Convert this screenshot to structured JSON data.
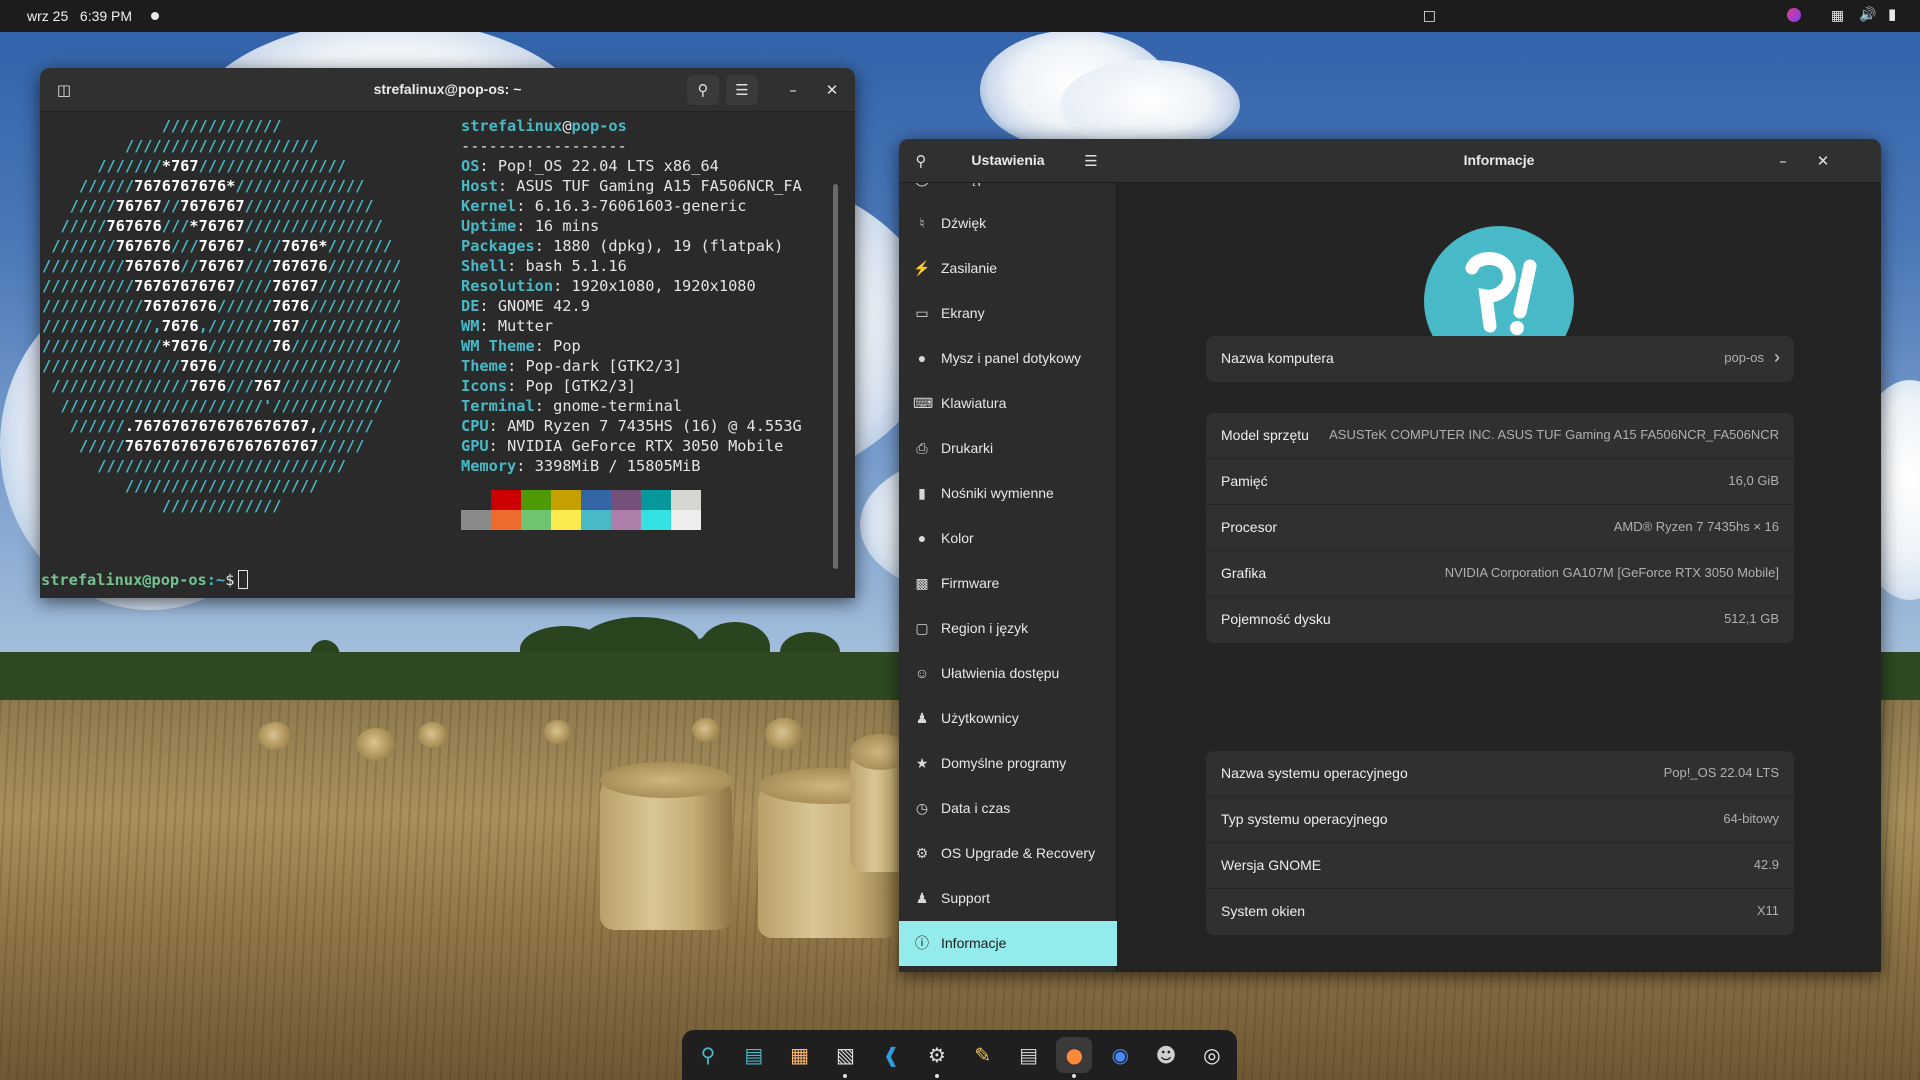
{
  "topbar": {
    "date": "wrz 25",
    "time": "6:39 PM",
    "tray_icons": [
      "screen-share-icon",
      "profile-icon",
      "keyboard-icon",
      "volume-icon",
      "battery-icon"
    ]
  },
  "terminal": {
    "title": "strefalinux@pop-os: ~",
    "neofetch": {
      "user": "strefalinux",
      "at": "@",
      "host": "pop-os",
      "separator": "------------------",
      "fields": [
        {
          "key": "OS",
          "value": "Pop!_OS 22.04 LTS x86_64"
        },
        {
          "key": "Host",
          "value": "ASUS TUF Gaming A15 FA506NCR_FA"
        },
        {
          "key": "Kernel",
          "value": "6.16.3-76061603-generic"
        },
        {
          "key": "Uptime",
          "value": "16 mins"
        },
        {
          "key": "Packages",
          "value": "1880 (dpkg), 19 (flatpak)"
        },
        {
          "key": "Shell",
          "value": "bash 5.1.16"
        },
        {
          "key": "Resolution",
          "value": "1920x1080, 1920x1080"
        },
        {
          "key": "DE",
          "value": "GNOME 42.9"
        },
        {
          "key": "WM",
          "value": "Mutter"
        },
        {
          "key": "WM Theme",
          "value": "Pop"
        },
        {
          "key": "Theme",
          "value": "Pop-dark [GTK2/3]"
        },
        {
          "key": "Icons",
          "value": "Pop [GTK2/3]"
        },
        {
          "key": "Terminal",
          "value": "gnome-terminal"
        },
        {
          "key": "CPU",
          "value": "AMD Ryzen 7 7435HS (16) @ 4.553G"
        },
        {
          "key": "GPU",
          "value": "NVIDIA GeForce RTX 3050 Mobile"
        },
        {
          "key": "Memory",
          "value": "3398MiB / 15805MiB"
        }
      ],
      "palette_top": [
        "#2a2a2a",
        "#cc0000",
        "#4e9a06",
        "#c4a000",
        "#3465a4",
        "#75507b",
        "#06989a",
        "#d3d7cf"
      ],
      "palette_bottom": [
        "#8a8a8a",
        "#ef6a2d",
        "#6fc46f",
        "#fce94f",
        "#48b9c7",
        "#ad7fa8",
        "#34e2e2",
        "#eeeeec"
      ]
    },
    "prompt_user": "strefalinux@pop-os",
    "prompt_path": ":~",
    "prompt_symbol": "$"
  },
  "settings": {
    "sidebar_title": "Ustawienia",
    "main_title": "Informacje",
    "sidebar_items": [
      {
        "label": "Dostępność",
        "icon": "accessibility-icon"
      },
      {
        "label": "Dźwięk",
        "icon": "sound-icon"
      },
      {
        "label": "Zasilanie",
        "icon": "power-icon"
      },
      {
        "label": "Ekrany",
        "icon": "display-icon"
      },
      {
        "label": "Mysz i panel dotykowy",
        "icon": "mouse-icon"
      },
      {
        "label": "Klawiatura",
        "icon": "keyboard-icon"
      },
      {
        "label": "Drukarki",
        "icon": "printer-icon"
      },
      {
        "label": "Nośniki wymienne",
        "icon": "removable-media-icon"
      },
      {
        "label": "Kolor",
        "icon": "color-icon"
      },
      {
        "label": "Firmware",
        "icon": "firmware-icon"
      },
      {
        "label": "Region i język",
        "icon": "region-icon"
      },
      {
        "label": "Ułatwienia dostępu",
        "icon": "universal-access-icon"
      },
      {
        "label": "Użytkownicy",
        "icon": "users-icon"
      },
      {
        "label": "Domyślne programy",
        "icon": "star-icon"
      },
      {
        "label": "Data i czas",
        "icon": "clock-icon"
      },
      {
        "label": "OS Upgrade & Recovery",
        "icon": "gear-icon"
      },
      {
        "label": "Support",
        "icon": "support-icon"
      },
      {
        "label": "Informacje",
        "icon": "info-icon"
      }
    ],
    "computer_name": {
      "label": "Nazwa komputera",
      "value": "pop-os"
    },
    "hardware": [
      {
        "label": "Model sprzętu",
        "value": "ASUSTeK COMPUTER INC. ASUS TUF Gaming A15 FA506NCR_FA506NCR"
      },
      {
        "label": "Pamięć",
        "value": "16,0 GiB"
      },
      {
        "label": "Procesor",
        "value": "AMD® Ryzen 7 7435hs × 16"
      },
      {
        "label": "Grafika",
        "value": "NVIDIA Corporation GA107M [GeForce RTX 3050 Mobile]"
      },
      {
        "label": "Pojemność dysku",
        "value": "512,1 GB"
      }
    ],
    "os": [
      {
        "label": "Nazwa systemu operacyjnego",
        "value": "Pop!_OS 22.04 LTS"
      },
      {
        "label": "Typ systemu operacyjnego",
        "value": "64-bitowy"
      },
      {
        "label": "Wersja GNOME",
        "value": "42.9"
      },
      {
        "label": "System okien",
        "value": "X11"
      }
    ]
  },
  "dock": {
    "apps": [
      "workspaces-icon",
      "applications-grid-icon",
      "app-grid-icon",
      "terminal-icon",
      "vscode-icon",
      "settings-icon",
      "text-editor-icon",
      "files-icon",
      "firefox-icon",
      "chrome-icon",
      "gimp-icon",
      "obs-icon"
    ]
  }
}
